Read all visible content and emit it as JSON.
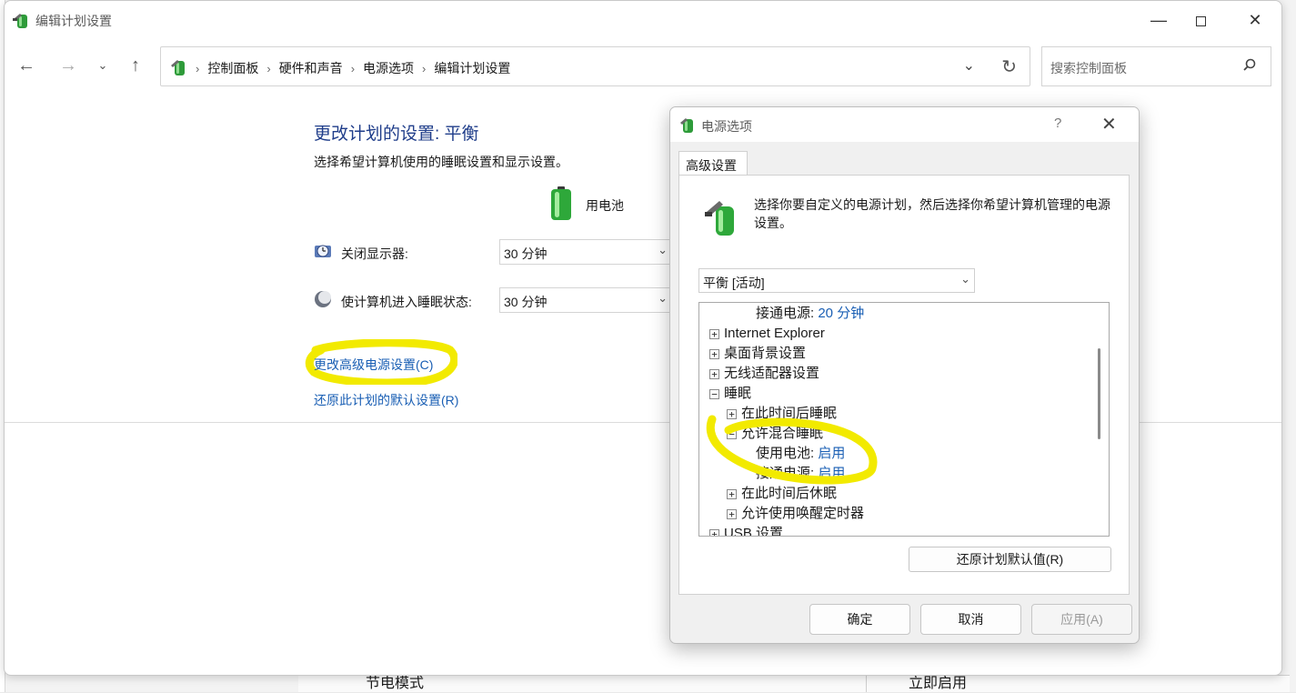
{
  "window": {
    "title": "编辑计划设置"
  },
  "nav": {
    "breadcrumbs": [
      "控制面板",
      "硬件和声音",
      "电源选项",
      "编辑计划设置"
    ],
    "search_placeholder": "搜索控制面板"
  },
  "main": {
    "heading": "更改计划的设置: 平衡",
    "subheading": "选择希望计算机使用的睡眠设置和显示设置。",
    "battery_label": "用电池",
    "display_off_label": "关闭显示器:",
    "display_off_value": "30 分钟",
    "sleep_label": "使计算机进入睡眠状态:",
    "sleep_value": "30 分钟",
    "advanced_link": "更改高级电源设置(C)",
    "restore_link": "还原此计划的默认设置(R)"
  },
  "background": {
    "row_label": "节电模式",
    "row_action": "立即启用"
  },
  "dialog": {
    "title": "电源选项",
    "help_glyph": "?",
    "tab_label": "高级设置",
    "description": "选择你要自定义的电源计划，然后选择你希望计算机管理的电源设置。",
    "plan_value": "平衡 [活动]",
    "tree": [
      {
        "indent": 2,
        "toggle": "",
        "label": "接通电源:",
        "value": "20 分钟"
      },
      {
        "indent": 0,
        "toggle": "+",
        "label": "Internet Explorer",
        "value": ""
      },
      {
        "indent": 0,
        "toggle": "+",
        "label": "桌面背景设置",
        "value": ""
      },
      {
        "indent": 0,
        "toggle": "+",
        "label": "无线适配器设置",
        "value": ""
      },
      {
        "indent": 0,
        "toggle": "−",
        "label": "睡眠",
        "value": ""
      },
      {
        "indent": 1,
        "toggle": "+",
        "label": "在此时间后睡眠",
        "value": ""
      },
      {
        "indent": 1,
        "toggle": "−",
        "label": "允许混合睡眠",
        "value": ""
      },
      {
        "indent": 2,
        "toggle": "",
        "label": "使用电池:",
        "value": "启用"
      },
      {
        "indent": 2,
        "toggle": "",
        "label": "接通电源:",
        "value": "启用"
      },
      {
        "indent": 1,
        "toggle": "+",
        "label": "在此时间后休眠",
        "value": ""
      },
      {
        "indent": 1,
        "toggle": "+",
        "label": "允许使用唤醒定时器",
        "value": ""
      },
      {
        "indent": 0,
        "toggle": "+",
        "label": "USB 设置",
        "value": ""
      }
    ],
    "restore_defaults": "还原计划默认值(R)",
    "ok": "确定",
    "cancel": "取消",
    "apply": "应用(A)"
  },
  "colors": {
    "link": "#1a5fb4",
    "heading": "#1f3d8a",
    "highlight": "#f2ea00"
  }
}
